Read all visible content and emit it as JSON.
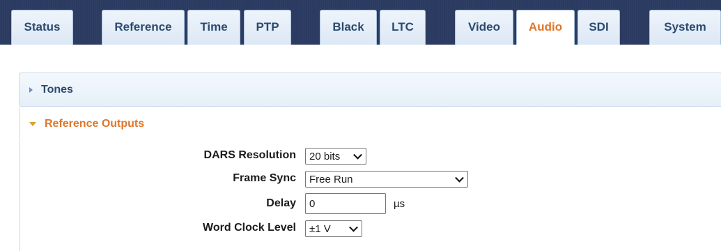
{
  "tabs": [
    {
      "label": "Status",
      "active": false
    },
    {
      "label": "Reference",
      "active": false
    },
    {
      "label": "Time",
      "active": false
    },
    {
      "label": "PTP",
      "active": false
    },
    {
      "label": "Black",
      "active": false
    },
    {
      "label": "LTC",
      "active": false
    },
    {
      "label": "Video",
      "active": false
    },
    {
      "label": "Audio",
      "active": true
    },
    {
      "label": "SDI",
      "active": false
    },
    {
      "label": "System",
      "active": false
    }
  ],
  "sections": {
    "tones": {
      "title": "Tones",
      "expanded": false,
      "icon": "caret-right-icon"
    },
    "reference_outputs": {
      "title": "Reference Outputs",
      "expanded": true,
      "icon": "caret-down-icon"
    }
  },
  "form": {
    "dars_resolution": {
      "label": "DARS Resolution",
      "value": "20 bits"
    },
    "frame_sync": {
      "label": "Frame Sync",
      "value": "Free Run"
    },
    "delay": {
      "label": "Delay",
      "value": "0",
      "unit": "µs"
    },
    "word_clock_level": {
      "label": "Word Clock Level",
      "value": "±1 V"
    }
  },
  "colors": {
    "tabbar_bg": "#2b3a60",
    "tab_text": "#2c4a6e",
    "active_tab_text": "#e0762a",
    "expanded_caret": "#e0a020"
  }
}
